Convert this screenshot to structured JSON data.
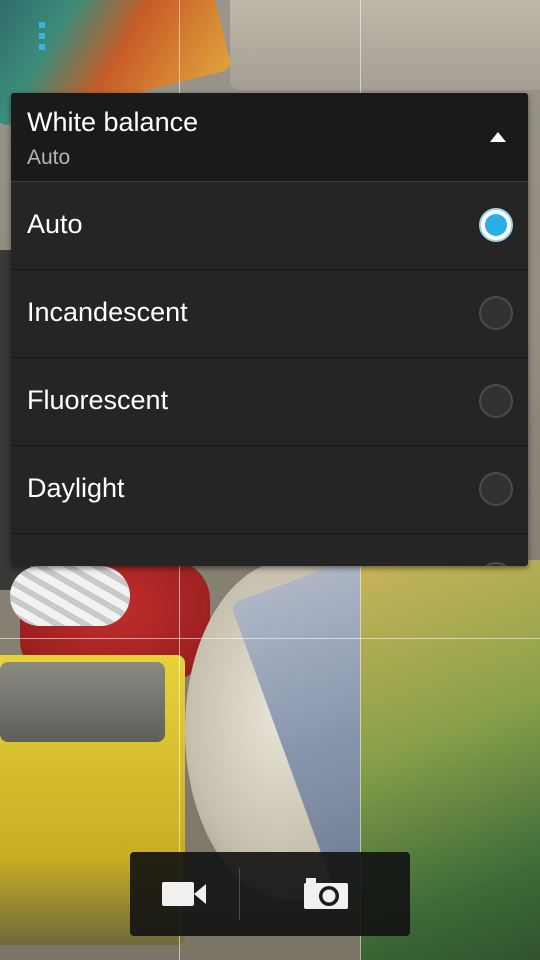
{
  "white_balance_panel": {
    "title": "White balance",
    "current_value": "Auto",
    "options": [
      {
        "label": "Auto",
        "selected": true
      },
      {
        "label": "Incandescent",
        "selected": false
      },
      {
        "label": "Fluorescent",
        "selected": false
      },
      {
        "label": "Daylight",
        "selected": false
      }
    ],
    "collapse_icon": "triangle-up-icon"
  },
  "capture_bar": {
    "video_icon": "video-camera-icon",
    "photo_icon": "camera-icon"
  },
  "colors": {
    "accent": "#29aee8",
    "panel_bg": "#252525",
    "header_bg": "#1a1a1a"
  }
}
